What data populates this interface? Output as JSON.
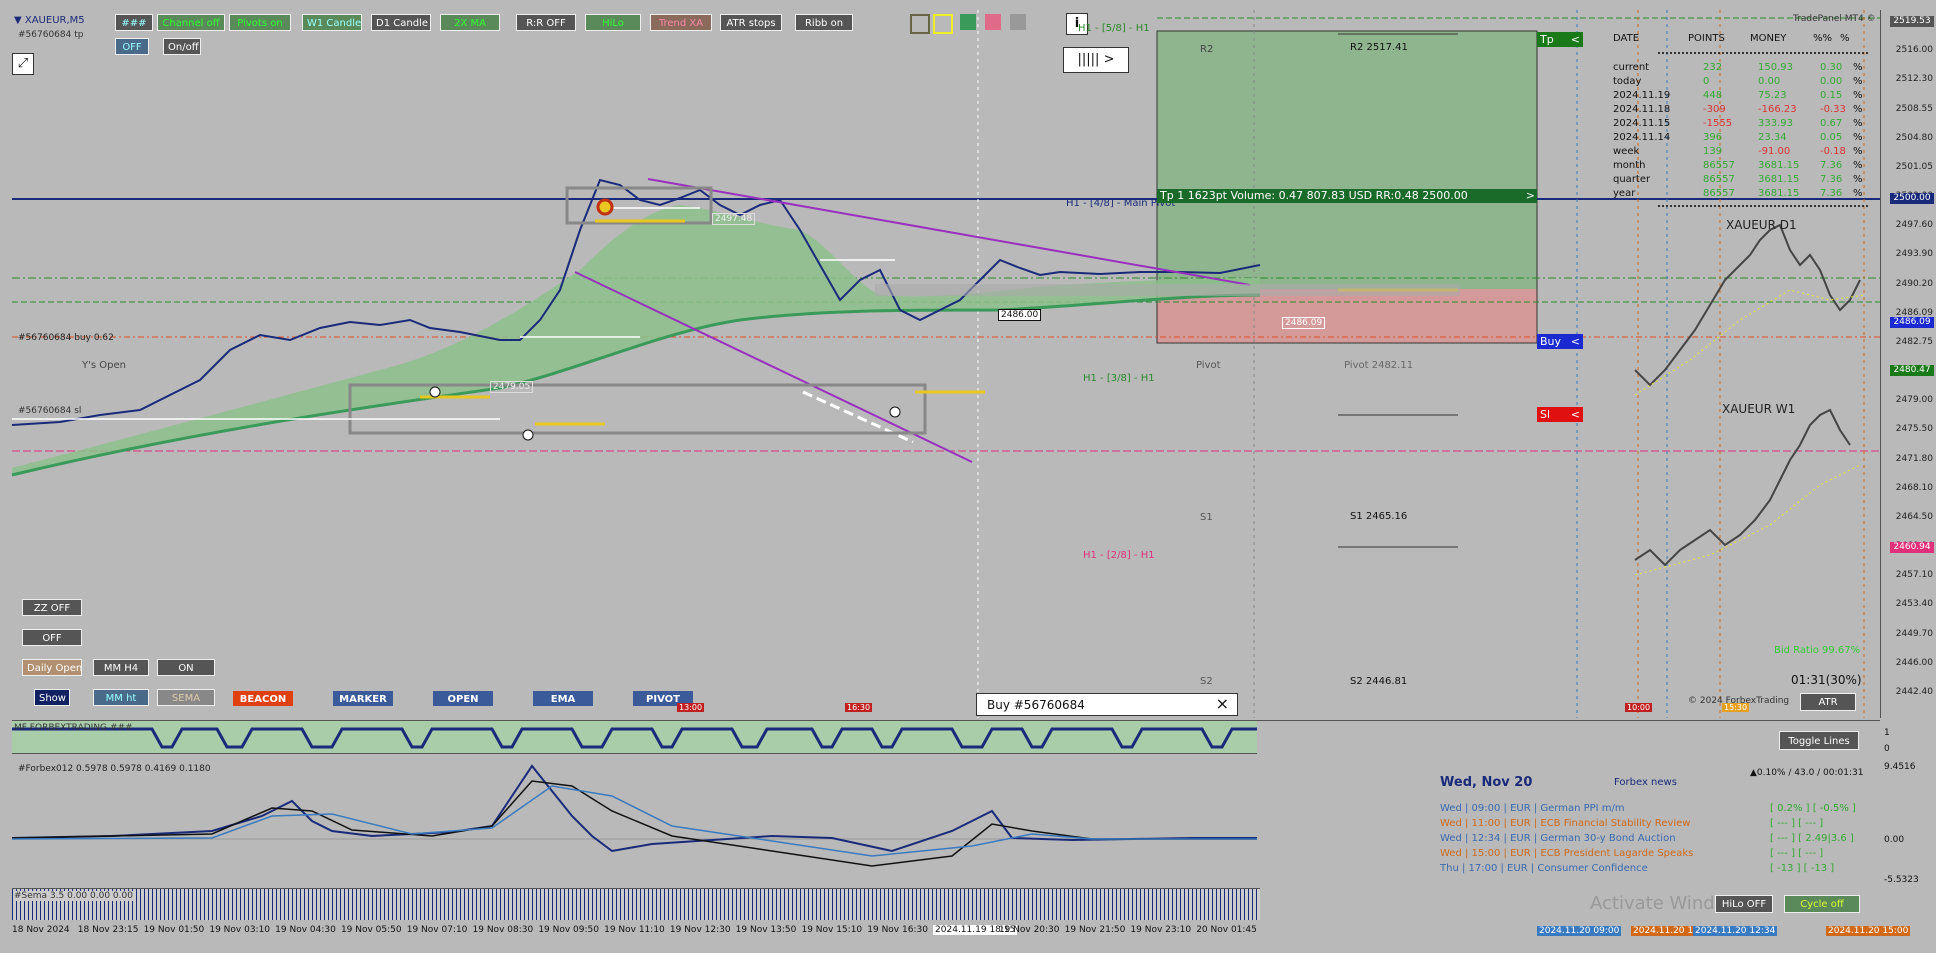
{
  "symbol": "▼ XAUEUR,M5",
  "order_tp_label": "#56760684 tp",
  "order_buy_label": "#56760684 buy 0.62",
  "order_sl_label": "#56760684 sl",
  "ys_open": "Y's Open",
  "top_buttons": [
    "###",
    "Channel off",
    "Pivots on",
    "W1 Candle",
    "D1 Candle",
    "2X MA",
    "R:R OFF",
    "HiLo",
    "Trend XA",
    "ATR stops",
    "Ribb on"
  ],
  "sub_buttons": [
    "OFF",
    "On/off"
  ],
  "info_btn": "i",
  "nav_btn": "||||| >",
  "left_panel": {
    "zz": "ZZ OFF",
    "off": "OFF",
    "daily_open": "Daily Open",
    "mm_h4": "MM H4",
    "on": "ON",
    "show": "Show",
    "mm_ht": "MM ht",
    "sema": "SEMA"
  },
  "tabs": [
    "BEACON",
    "MARKER",
    "OPEN",
    "EMA",
    "PIVOT"
  ],
  "tp_panel": {
    "tp_label": "Tp",
    "buy_label": "Buy",
    "sl_label": "Sl",
    "tp_text": "Tp 1   1623pt   Volume: 0.47   807.83 USD   RR:0.48   2500.00"
  },
  "levels": {
    "r2": "R2",
    "r2_value": "R2 2517.41",
    "h1_58": "H1 - [5/8] - H1",
    "main_pivot": "H1 - [4/8] - Main Pivot",
    "h1_38": "H1 - [3/8] - H1",
    "h1_28": "H1 - [2/8] - H1",
    "pivot": "Pivot",
    "pivot_value": "Pivot 2482.11",
    "s1": "S1",
    "s1_value": "S1 2465.16",
    "s2": "S2",
    "s2_value": "S2 2446.81"
  },
  "price_tags": {
    "p1": "2486.00",
    "p2": "2486.09",
    "p3": "2479.05",
    "p4": "2497.48"
  },
  "trade_panel": {
    "title": "TradePanel MT4 ©",
    "headers": [
      "DATE",
      "POINTS",
      "MONEY",
      "%%",
      "%"
    ],
    "rows": [
      [
        "current",
        "232",
        "150.93",
        "0.30",
        "%"
      ],
      [
        "today",
        "0",
        "0.00",
        "0.00",
        "%"
      ],
      [
        "2024.11.19",
        "448",
        "75.23",
        "0.15",
        "%"
      ],
      [
        "2024.11.18",
        "-309",
        "-166.23",
        "-0.33",
        "%"
      ],
      [
        "2024.11.15",
        "-1555",
        "333.93",
        "0.67",
        "%"
      ],
      [
        "2024.11.14",
        "396",
        "23.34",
        "0.05",
        "%"
      ],
      [
        "week",
        "139",
        "-91.00",
        "-0.18",
        "%"
      ],
      [
        "month",
        "86557",
        "3681.15",
        "7.36",
        "%"
      ],
      [
        "quarter",
        "86557",
        "3681.15",
        "7.36",
        "%"
      ],
      [
        "year",
        "86557",
        "3681.15",
        "7.36",
        "%"
      ]
    ]
  },
  "mini_d1": "XAUEUR D1",
  "mini_w1": "XAUEUR W1",
  "bid_ratio": "Bid Ratio 99.67%",
  "timer": "01:31(30%)",
  "copyright": "© 2024 ForbexTrading",
  "atr_btn": "ATR",
  "toggle_lines": "Toggle Lines",
  "buy_dialog": {
    "title": "Buy  #56760684",
    "close": "×"
  },
  "session_markers": [
    "13:00",
    "16:30",
    "10:00",
    "15:30"
  ],
  "price_axis": [
    "2519.53",
    "2516.00",
    "2512.30",
    "2508.55",
    "2504.80",
    "2501.05",
    "2500.00",
    "2497.60",
    "2493.90",
    "2490.20",
    "2486.09",
    "2482.75",
    "2480.47",
    "2479.00",
    "2475.50",
    "2471.80",
    "2468.10",
    "2464.50",
    "2460.94",
    "2457.10",
    "2453.40",
    "2449.70",
    "2446.00",
    "2442.40"
  ],
  "osc1": {
    "label": "MF FORBEXTRADING ###",
    "axis": [
      "1",
      "0"
    ]
  },
  "osc2": {
    "label": "#Forbex012 0.5978 0.5978 0.4169 0.1180",
    "axis": [
      "9.4516",
      "0.00",
      "-5.5323"
    ]
  },
  "osc3": {
    "label": "#Sema 3.5 0.00 0.00 0.00"
  },
  "news": {
    "date": "Wed, Nov 20",
    "source": "Forbex news",
    "stat": "▲0.10% / 43.0 / 00:01:31",
    "items": [
      {
        "text": "Wed  |  09:00  |  EUR  |  German PPI m/m",
        "vals": "[ 0.2% ]   [ -0.5% ]",
        "color": "#3a6ab0"
      },
      {
        "text": "Wed  |  11:00  |  EUR  |  ECB Financial Stability Review",
        "vals": "[ --- ]   [ --- ]",
        "color": "#d06a1a"
      },
      {
        "text": "Wed  |  12:34  |  EUR  |  German 30-y Bond Auction",
        "vals": "[ --- ]   [ 2.49|3.6 ]",
        "color": "#3a6ab0"
      },
      {
        "text": "Wed  |  15:00  |  EUR  |  ECB President Lagarde Speaks",
        "vals": "[ --- ]   [ --- ]",
        "color": "#d06a1a"
      },
      {
        "text": "Thu  |  17:00  |  EUR  |  Consumer Confidence",
        "vals": "[ -13 ]   [ -13 ]",
        "color": "#3a6ab0"
      }
    ]
  },
  "activate": "Activate Windows",
  "hilo_off": "HiLo OFF",
  "cycle_off": "Cycle off",
  "time_axis": [
    "18 Nov 2024",
    "18 Nov 23:15",
    "19 Nov 01:50",
    "19 Nov 03:10",
    "19 Nov 04:30",
    "19 Nov 05:50",
    "19 Nov 07:10",
    "19 Nov 08:30",
    "19 Nov 09:50",
    "19 Nov 11:10",
    "19 Nov 12:30",
    "19 Nov 13:50",
    "19 Nov 15:10",
    "19 Nov 16:30",
    "2024.11.19 18:15",
    "19 Nov 20:30",
    "19 Nov 21:50",
    "19 Nov 23:10",
    "20 Nov 01:45"
  ],
  "bottom_dates": [
    "2024.11.20 09:00",
    "2024.11.20 11:00",
    "2024.11.20 12:34",
    "2024.11.20 15:00"
  ]
}
